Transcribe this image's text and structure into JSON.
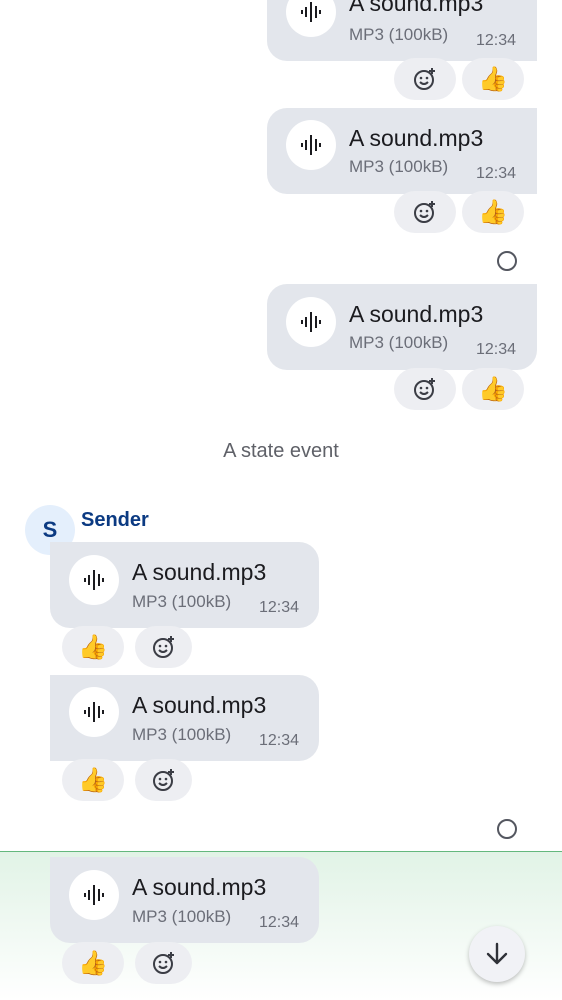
{
  "file": {
    "name": "A sound.mp3",
    "meta": "MP3 (100kB)",
    "time": "12:34"
  },
  "state_event": "A state event",
  "sender": {
    "name": "Sender",
    "initial": "S",
    "color": "#0b3a82",
    "avatar_bg": "#e4effc"
  },
  "reactions": {
    "thumbs_up": "👍",
    "add_reaction_icon": "add-reaction-icon"
  },
  "colors": {
    "bubble": "#e3e6ec",
    "highlight_border": "#64b87d",
    "highlight_bg": "#e1f3e6"
  },
  "icons": {
    "audio": "audio-waveform-icon",
    "receipt": "read-receipt-icon",
    "scroll_down": "arrow-down-icon"
  }
}
